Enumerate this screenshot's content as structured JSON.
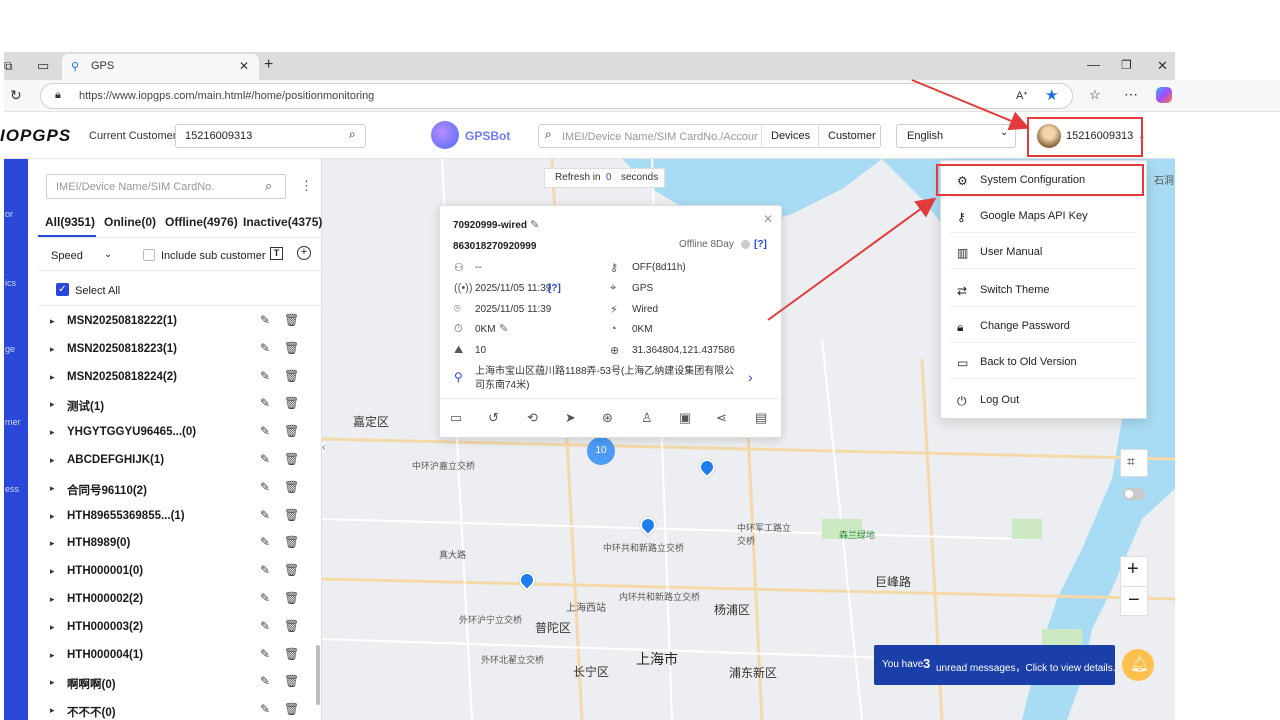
{
  "browser": {
    "tab_title": "GPS",
    "url": "https://www.iopgps.com/main.html#/home/positionmonitoring"
  },
  "header": {
    "logo": "IOPGPS",
    "customer_label": "Current Customer",
    "customer_value": "15216009313",
    "gpsbot": "GPSBot",
    "search_placeholder": "IMEI/Device Name/SIM CardNo./Accoun...",
    "devices_btn": "Devices",
    "customer_btn": "Customer",
    "language": "English",
    "username": "15216009313"
  },
  "leftnav": {
    "items": [
      "or",
      "ics",
      "ge",
      "mer",
      "ess"
    ]
  },
  "panel": {
    "search_placeholder": "IMEI/Device Name/SIM CardNo.",
    "tabs": [
      "All(9351)",
      "Online(0)",
      "Offline(4976)",
      "Inactive(4375)"
    ],
    "sort_value": "Speed",
    "include_sub": "Include sub customer",
    "select_all": "Select All",
    "groups": [
      "MSN20250818222(1)",
      "MSN20250818223(1)",
      "MSN20250818224(2)",
      "测试(1)",
      "YHGYTGGYU96465...(0)",
      "ABCDEFGHIJK(1)",
      "合同号96110(2)",
      "HTH89655369855...(1)",
      "HTH8989(0)",
      "HTH000001(0)",
      "HTH000002(2)",
      "HTH000003(2)",
      "HTH000004(1)",
      "啊啊啊(0)",
      "不不不(0)"
    ]
  },
  "map": {
    "refresh_prefix": "Refresh in",
    "refresh_value": "0",
    "refresh_suffix": "seconds",
    "cluster_count": "10",
    "labels": [
      "嘉定区",
      "上海西站",
      "普陀区",
      "长宁区",
      "上海市",
      "杨浦区",
      "浦东新区",
      "中环共和新路立交桥",
      "中环军工路立交桥",
      "森兰绿地",
      "巨峰路",
      "真大路",
      "内环共和新路立交桥",
      "外环沪宁立交桥",
      "外环北翟立交桥",
      "中环沪嘉立交桥"
    ],
    "notification_prefix": "You have",
    "notification_count": "3",
    "notification_suffix": "unread messages，Click to view details."
  },
  "popup": {
    "device_name": "70920999-wired",
    "imei": "863018270920999",
    "status": "Offline 8Day",
    "help": "[?]",
    "person": "--",
    "acc": "OFF(8d11h)",
    "signal_time": "2025/11/05 11:39",
    "signal_help": "[?]",
    "positioning": "GPS",
    "gps_time": "2025/11/05 11:39",
    "power": "Wired",
    "mileage": "0KM",
    "speed": "0KM",
    "satellites": "10",
    "coords": "31.364804,121.437586",
    "address": "上海市宝山区蕴川路1188弄-53号(上海乙纳建设集团有限公司东南74米)"
  },
  "dropdown": {
    "items": [
      {
        "label": "System Configuration",
        "icon": "gear-icon"
      },
      {
        "label": "Google Maps API Key",
        "icon": "key-icon"
      },
      {
        "label": "User Manual",
        "icon": "book-icon"
      },
      {
        "label": "Switch Theme",
        "icon": "swap-icon"
      },
      {
        "label": "Change Password",
        "icon": "lock-icon"
      },
      {
        "label": "Back to Old Version",
        "icon": "monitor-icon"
      },
      {
        "label": "Log Out",
        "icon": "power-icon"
      }
    ]
  },
  "colors": {
    "brand_blue": "#2a48d8",
    "annotation_red": "#e23b3b",
    "pin_blue": "#1e7ef0",
    "notify_bg": "#1a3fa8"
  }
}
